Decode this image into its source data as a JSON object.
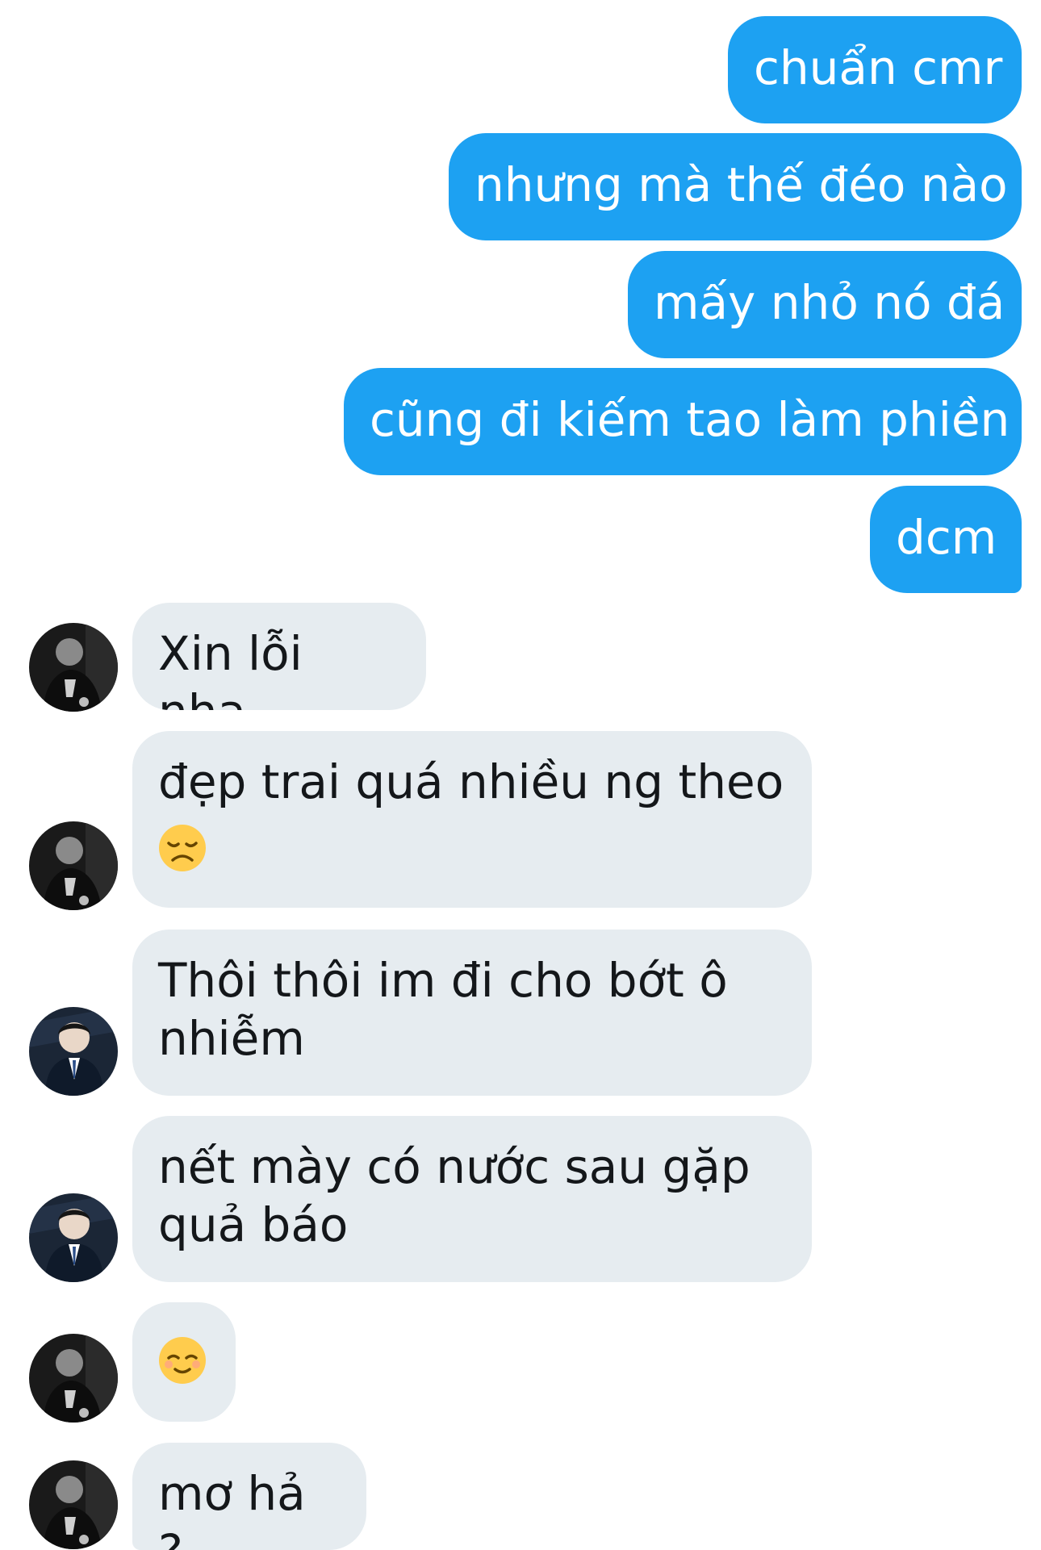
{
  "conversation": {
    "sent": [
      {
        "text": "chuẩn cmr"
      },
      {
        "text": "nhưng mà thế đéo nào"
      },
      {
        "text": "mấy nhỏ nó đá"
      },
      {
        "text": "cũng đi kiếm tao làm phiền"
      },
      {
        "text": "dcm"
      }
    ],
    "received": [
      {
        "text": "Xin lỗi nha",
        "avatar_icon": "avatar-dark-photo-icon"
      },
      {
        "text": "đẹp trai quá nhiều ng theo",
        "emoji": "disappointed-face-emoji",
        "avatar_icon": "avatar-dark-photo-icon"
      },
      {
        "text": "Thôi thôi im đi cho bớt ô nhiễm",
        "avatar_icon": "avatar-suit-photo-icon"
      },
      {
        "text": "nết mày có nước sau gặp quả báo",
        "avatar_icon": "avatar-suit-photo-icon"
      },
      {
        "text": "",
        "emoji": "relieved-face-emoji",
        "avatar_icon": "avatar-dark-photo-icon"
      },
      {
        "text": "mơ hả ?",
        "avatar_icon": "avatar-dark-photo-icon"
      }
    ]
  },
  "colors": {
    "sent_bubble": "#1da1f2",
    "sent_text": "#ffffff",
    "received_bubble": "#e6ecf0",
    "received_text": "#14171a",
    "emoji_face": "#ffcc4d"
  }
}
